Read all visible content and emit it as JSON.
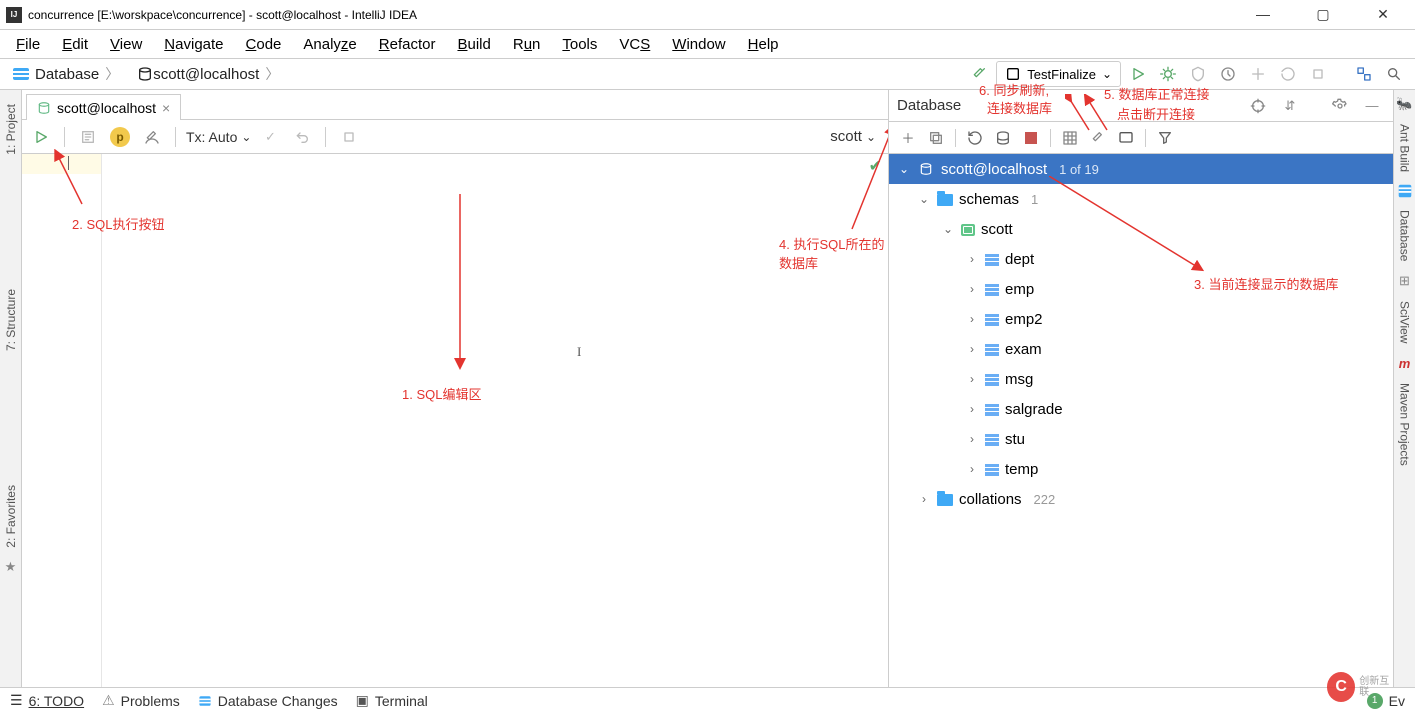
{
  "titlebar": {
    "icon_text": "IJ",
    "title": "concurrence [E:\\worskpace\\concurrence] - scott@localhost - IntelliJ IDEA"
  },
  "menu": [
    "File",
    "Edit",
    "View",
    "Navigate",
    "Code",
    "Analyze",
    "Refactor",
    "Build",
    "Run",
    "Tools",
    "VCS",
    "Window",
    "Help"
  ],
  "crumbs": {
    "a": "Database",
    "b": "scott@localhost"
  },
  "runconfig": {
    "label": "TestFinalize"
  },
  "tab": {
    "label": "scott@localhost"
  },
  "etoolbar": {
    "tx": "Tx: Auto",
    "scott": "scott",
    "p_badge": "p"
  },
  "annotations": {
    "a1": "1.  SQL编辑区",
    "a2": "2. SQL执行按钮",
    "a3": "3. 当前连接显示的数据库",
    "a4": "4. 执行SQL所在的数据库",
    "a5": "5. 数据库正常连接",
    "a6a": "6. 同步刷新,",
    "a6b": "连接数据库",
    "a7": "点击断开连接"
  },
  "dbpanel": {
    "title": "Database",
    "root": {
      "label": "scott@localhost",
      "count": "1 of 19"
    },
    "schemas_label": "schemas",
    "schemas_count": "1",
    "schema": "scott",
    "tables": [
      "dept",
      "emp",
      "emp2",
      "exam",
      "msg",
      "salgrade",
      "stu",
      "temp"
    ],
    "collations_label": "collations",
    "collations_count": "222"
  },
  "left_gutter": {
    "project": "1: Project",
    "structure": "7: Structure",
    "favorites": "2: Favorites"
  },
  "right_gutter": {
    "ant": "Ant Build",
    "database": "Database",
    "sciview": "SciView",
    "maven": "Maven Projects",
    "m": "m"
  },
  "status": {
    "todo": "6: TODO",
    "problems": "Problems",
    "dbchanges": "Database Changes",
    "terminal": "Terminal",
    "ev": "Ev",
    "ev_icon": "1"
  },
  "watermark": {
    "c": "C",
    "t": "创新互联"
  }
}
